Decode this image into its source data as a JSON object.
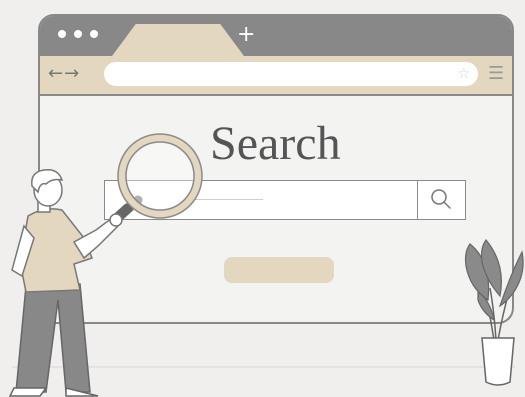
{
  "browser": {
    "new_tab_glyph": "+",
    "nav_back_glyph": "←",
    "nav_forward_glyph": "→",
    "star_glyph": "☆",
    "menu_glyph": "☰"
  },
  "content": {
    "title": "Search"
  },
  "icons": [
    "search-icon",
    "magnifying-glass-illustration",
    "plant-illustration",
    "person-illustration"
  ],
  "colors": {
    "beige": "#e4d7bf",
    "gray": "#888888",
    "background": "#f0efee"
  }
}
